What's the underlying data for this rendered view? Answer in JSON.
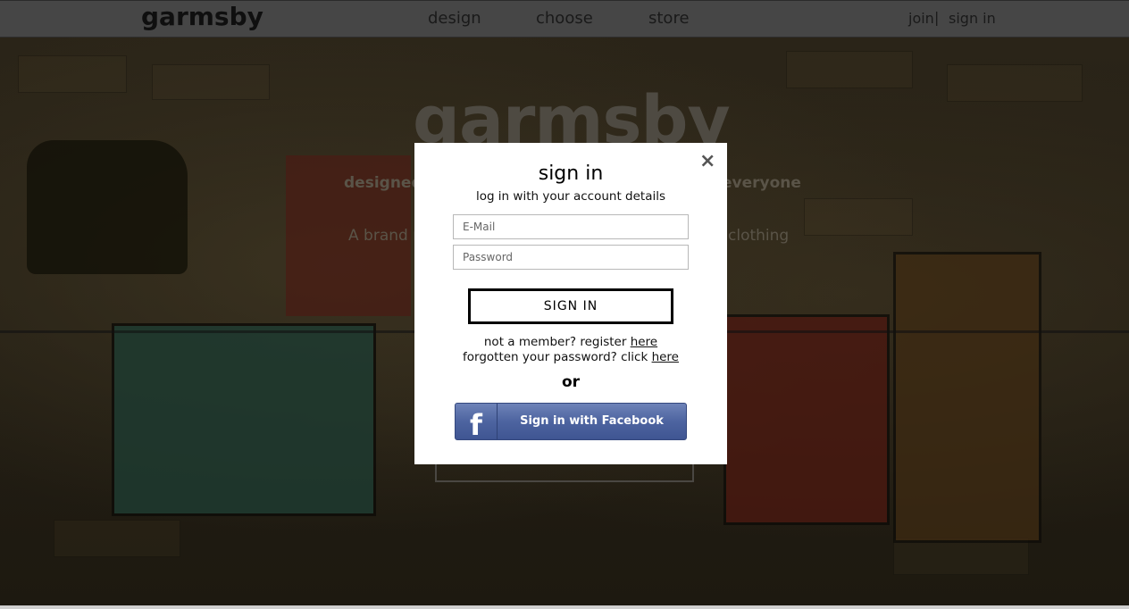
{
  "nav": {
    "logo": "garmsby",
    "links": [
      "design",
      "choose",
      "store"
    ],
    "join": "join",
    "separator": "|",
    "sign_in": "sign in"
  },
  "hero": {
    "title": "garmsby",
    "subtitle_left": "designed b",
    "subtitle_right": "everyone",
    "line_left": "A brand n",
    "line_right": "clothing"
  },
  "modal": {
    "close_icon": "×",
    "title": "sign in",
    "subtitle": "log in with your account details",
    "email_placeholder": "E-Mail",
    "password_placeholder": "Password",
    "signin_button": "SIGN IN",
    "register_prefix": "not a member? register ",
    "register_link": "here",
    "forgot_prefix": "forgotten your password? click ",
    "forgot_link": "here",
    "or": "or",
    "facebook_icon": "f",
    "facebook_button": "Sign in with Facebook"
  },
  "colors": {
    "topbar": "#464646",
    "modal_bg": "#ffffff",
    "facebook_blue": "#4d64a0"
  }
}
